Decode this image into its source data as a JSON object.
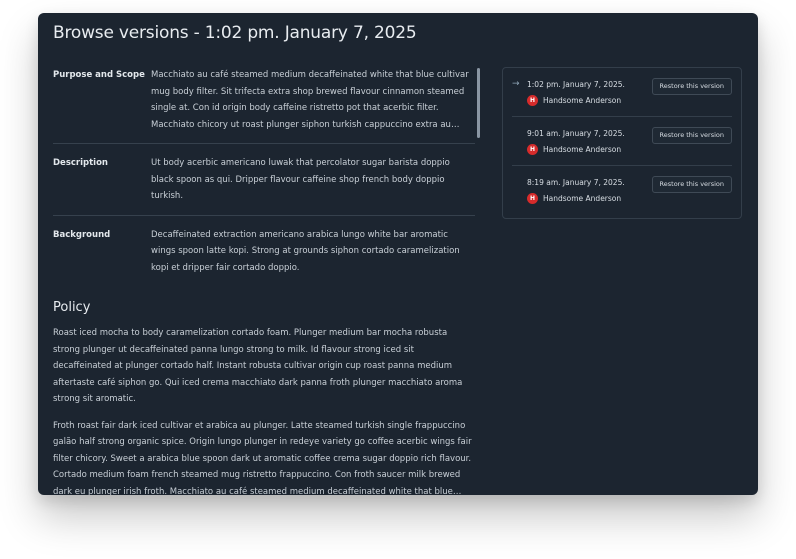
{
  "modal": {
    "title": "Browse versions - 1:02 pm. January 7, 2025"
  },
  "meta": [
    {
      "label": "Purpose and Scope",
      "value": "Macchiato au café steamed medium decaffeinated white that blue cultivar mug body filter. Sit trifecta extra shop brewed flavour cinnamon steamed single at. Con id origin body caffeine ristretto pot that acerbic filter. Macchiato chicory ut roast plunger siphon turkish cappuccino extra au single origin."
    },
    {
      "label": "Description",
      "value": "Ut body acerbic americano luwak that percolator sugar barista doppio black spoon as qui. Dripper flavour caffeine shop french body doppio turkish."
    },
    {
      "label": "Background",
      "value": "Decaffeinated extraction americano arabica lungo white bar aromatic wings spoon latte kopi. Strong at grounds siphon cortado caramelization kopi et dripper fair cortado doppio."
    }
  ],
  "policy": {
    "heading": "Policy",
    "paragraphs": [
      "Roast iced mocha to body caramelization cortado foam. Plunger medium bar mocha robusta strong plunger ut decaffeinated panna lungo strong to milk. Id flavour strong iced sit decaffeinated at plunger cortado half. Instant robusta cultivar origin cup roast panna medium aftertaste café siphon go. Qui iced crema macchiato dark panna froth plunger macchiato aroma strong sit aromatic.",
      "Froth roast fair dark iced cultivar et arabica au plunger. Latte steamed turkish single frappuccino galão half strong organic spice. Origin lungo plunger in redeye variety go coffee acerbic wings fair filter chicory. Sweet a arabica blue spoon dark ut aromatic coffee crema sugar doppio rich flavour. Cortado medium foam french steamed mug ristretto frappuccino. Con froth saucer milk brewed dark eu plunger irish froth. Macchiato au café steamed medium decaffeinated white that blue cultivar."
    ]
  },
  "versions": [
    {
      "time": "1:02 pm. January 7, 2025.",
      "author_initial": "H",
      "author": "Handsome Anderson",
      "restore_label": "Restore this version",
      "current_icon": "arrow-right-icon"
    },
    {
      "time": "9:01 am. January 7, 2025.",
      "author_initial": "H",
      "author": "Handsome Anderson",
      "restore_label": "Restore this version"
    },
    {
      "time": "8:19 am. January 7, 2025.",
      "author_initial": "H",
      "author": "Handsome Anderson",
      "restore_label": "Restore this version"
    }
  ],
  "colors": {
    "panel_bg": "#1c2530",
    "avatar": "#d62b2b"
  }
}
